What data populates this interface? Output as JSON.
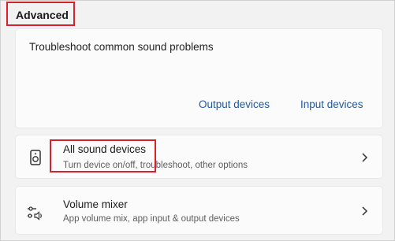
{
  "section": {
    "title": "Advanced"
  },
  "troubleshoot": {
    "title": "Troubleshoot common sound problems",
    "links": {
      "output": "Output devices",
      "input": "Input devices"
    }
  },
  "rows": [
    {
      "title": "All sound devices",
      "subtitle": "Turn device on/off, troubleshoot, other options",
      "icon": "speaker-icon"
    },
    {
      "title": "Volume mixer",
      "subtitle": "App volume mix, app input & output devices",
      "icon": "volume-mixer-icon"
    }
  ],
  "colors": {
    "highlight": "#d6232a",
    "link": "#1d5a9c"
  }
}
